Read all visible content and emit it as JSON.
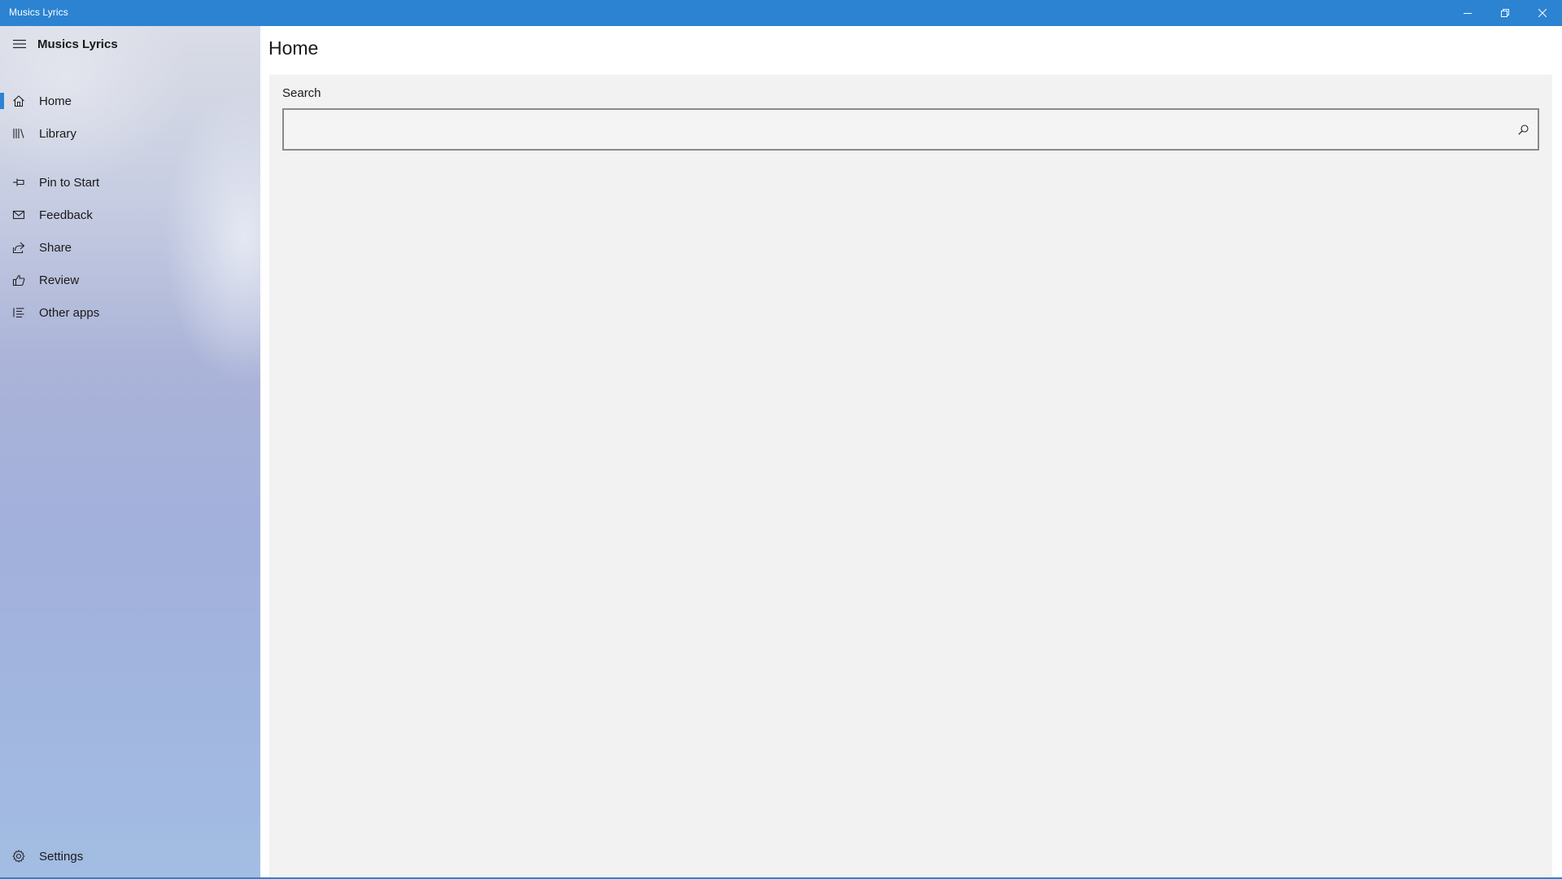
{
  "window": {
    "title": "Musics Lyrics",
    "controls": {
      "minimize_icon": "minimize-icon",
      "maximize_icon": "restore-icon",
      "close_icon": "close-icon"
    }
  },
  "colors": {
    "accent": "#2b83d2",
    "content_bg": "#f2f2f2",
    "text": "#1a1a1a"
  },
  "sidebar": {
    "app_name": "Musics Lyrics",
    "menu_icon": "hamburger-menu-icon",
    "items": [
      {
        "label": "Home",
        "icon": "home-icon",
        "selected": true
      },
      {
        "label": "Library",
        "icon": "library-icon",
        "selected": false
      },
      {
        "label": "Pin to Start",
        "icon": "pin-icon",
        "selected": false
      },
      {
        "label": "Feedback",
        "icon": "mail-icon",
        "selected": false
      },
      {
        "label": "Share",
        "icon": "share-icon",
        "selected": false
      },
      {
        "label": "Review",
        "icon": "thumbs-up-icon",
        "selected": false
      },
      {
        "label": "Other apps",
        "icon": "list-icon",
        "selected": false
      }
    ],
    "footer": {
      "label": "Settings",
      "icon": "gear-icon"
    }
  },
  "main": {
    "page_title": "Home",
    "search": {
      "label": "Search",
      "value": "",
      "placeholder": "",
      "button_icon": "search-icon"
    }
  }
}
